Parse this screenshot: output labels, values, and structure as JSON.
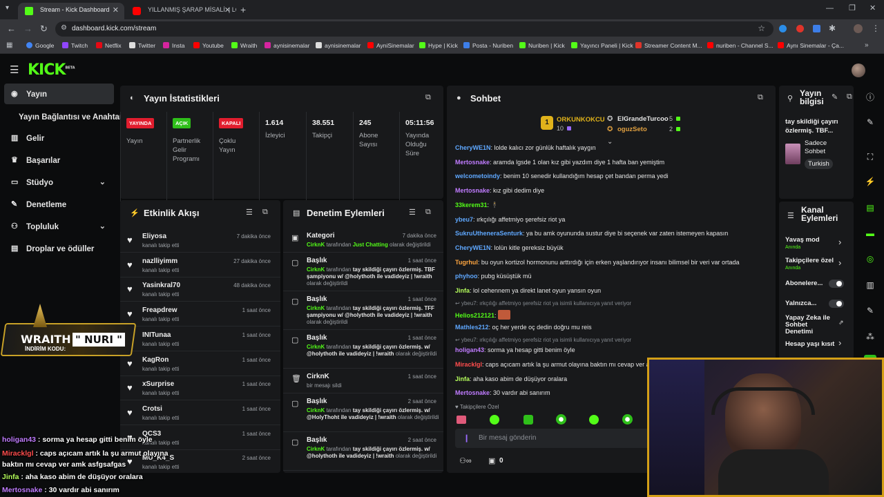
{
  "browser": {
    "tabs": [
      {
        "title": "Stream - Kick Dashboard",
        "active": true
      },
      {
        "title": "YILLANMIŞ ŞARAP MİSALİ. | LO",
        "active": false
      }
    ],
    "url": "dashboard.kick.com/stream",
    "bookmarks": [
      "Google",
      "Twitch",
      "Netflix",
      "Twitter",
      "Insta",
      "Youtube",
      "Wraith",
      "aynisinemalar",
      "aynisinemalar",
      "AyniSinemalar",
      "Hype | Kick",
      "Posta - Nuriben",
      "Nuriben | Kick",
      "Yayıncı Paneli | Kick",
      "Streamer Content M...",
      "nuriben - Channel S...",
      "Aynı Sinemalar - Ça..."
    ]
  },
  "brand": {
    "logo": "KICK",
    "beta": "BETA",
    "accent": "#53fc18"
  },
  "sidebar": {
    "items": [
      {
        "label": "Yayın",
        "icon": "broadcast-icon",
        "active": true
      },
      {
        "label": "Yayın Bağlantısı ve Anahtarı",
        "icon": "",
        "active": false
      },
      {
        "label": "Gelir",
        "icon": "bank-icon",
        "active": false
      },
      {
        "label": "Başarılar",
        "icon": "trophy-icon",
        "active": false
      },
      {
        "label": "Stüdyo",
        "icon": "monitor-icon",
        "active": false,
        "expandable": true
      },
      {
        "label": "Denetleme",
        "icon": "wrench-icon",
        "active": false
      },
      {
        "label": "Topluluk",
        "icon": "people-icon",
        "active": false,
        "expandable": true
      },
      {
        "label": "Droplar ve ödüller",
        "icon": "gift-icon",
        "active": false
      }
    ]
  },
  "stats": {
    "title": "Yayın İstatistikleri",
    "items": [
      {
        "badge": "YAYINDA",
        "badge_color": "#e11d2e",
        "label": "Yayın"
      },
      {
        "badge": "AÇIK",
        "badge_color": "#2fbf1a",
        "label": "Partnerlik Gelir Programı"
      },
      {
        "badge": "KAPALI",
        "badge_color": "#e11d2e",
        "label": "Çoklu Yayın"
      },
      {
        "value": "1.614",
        "label": "İzleyici"
      },
      {
        "value": "38.551",
        "label": "Takipçi"
      },
      {
        "value": "245",
        "label": "Abone Sayısı"
      },
      {
        "value": "05:11:56",
        "label": "Yayında Olduğu Süre"
      }
    ]
  },
  "activity": {
    "title": "Etkinlik Akışı",
    "rows": [
      {
        "name": "Eliyosa",
        "sub": "kanalı takip etti",
        "time": "7 dakika önce"
      },
      {
        "name": "nazlliyimm",
        "sub": "kanalı takip etti",
        "time": "27 dakika önce"
      },
      {
        "name": "Yasinkral70",
        "sub": "kanalı takip etti",
        "time": "48 dakika önce"
      },
      {
        "name": "Freapdrew",
        "sub": "kanalı takip etti",
        "time": "1 saat önce"
      },
      {
        "name": "INITunaa",
        "sub": "kanalı takip etti",
        "time": "1 saat önce"
      },
      {
        "name": "KagRon",
        "sub": "kanalı takip etti",
        "time": "1 saat önce"
      },
      {
        "name": "xSurprise",
        "sub": "kanalı takip etti",
        "time": "1 saat önce"
      },
      {
        "name": "Crotsi",
        "sub": "kanalı takip etti",
        "time": "1 saat önce"
      },
      {
        "name": "QCS3",
        "sub": "kanalı takip etti",
        "time": "1 saat önce"
      },
      {
        "name": "MU_K4_S",
        "sub": "kanalı takip etti",
        "time": "2 saat önce"
      }
    ]
  },
  "moderation": {
    "title": "Denetim Eylemleri",
    "rows": [
      {
        "icon": "category-icon",
        "title": "Kategori",
        "time": "7 dakika önce",
        "actor": "CirknK",
        "mid": " tarafından ",
        "target": "Just Chatting",
        "tail": " olarak değiştirildi"
      },
      {
        "icon": "title-icon",
        "title": "Başlık",
        "time": "1 saat önce",
        "actor": "CirknK",
        "mid": " tarafından ",
        "target": "tay skildiği çayırı özlermiş. TBF şampiyonu w/ @holythoth ile vadideyiz | !wraith",
        "tail": " olarak değiştirildi"
      },
      {
        "icon": "title-icon",
        "title": "Başlık",
        "time": "1 saat önce",
        "actor": "CirknK",
        "mid": " tarafından ",
        "target": "tay skildiği çayırı özlermiş. TFF şampiyonu w/ @holythoth ile vadideyiz | !wraith",
        "tail": " olarak değiştirildi"
      },
      {
        "icon": "title-icon",
        "title": "Başlık",
        "time": "1 saat önce",
        "actor": "CirknK",
        "mid": " tarafından ",
        "target": "tay skildiği çayırı özlermiş. w/ @holythoth ile vadideyiz | !wraith",
        "tail": " olarak değiştirildi"
      },
      {
        "icon": "trash-icon",
        "title": "CirknK",
        "time": "1 saat önce",
        "actor": "",
        "mid": "bir mesajı sildi",
        "target": "",
        "tail": ""
      },
      {
        "icon": "title-icon",
        "title": "Başlık",
        "time": "2 saat önce",
        "actor": "CirknK",
        "mid": " tarafından ",
        "target": "tay skildiği çayırı özlermiş. w/ @HolyThoht ile vadideyiz | !wraith",
        "tail": " olarak değiştirildi"
      },
      {
        "icon": "title-icon",
        "title": "Başlık",
        "time": "2 saat önce",
        "actor": "CirknK",
        "mid": " tarafından ",
        "target": "tay skildiği çayırı özlermiş. w/ @holythoth ile vadideyiz | !wraith",
        "tail": " olarak değiştirildi"
      }
    ]
  },
  "chat": {
    "title": "Sohbet",
    "leaderboard": [
      {
        "rank": "1",
        "name": "ORKUNKOKCU",
        "value": "10"
      },
      {
        "rank": "",
        "name": "ElGrandeTurcoo",
        "value": "5"
      },
      {
        "rank": "",
        "name": "oguzSeto",
        "value": "2"
      }
    ],
    "messages": [
      {
        "user": "CheryWE1N",
        "color": "#5fa8ff",
        "text": "lolde kalıcı zor günlük haftalık yaygın"
      },
      {
        "user": "Mertosnake",
        "color": "#c07cff",
        "text": "aramda lgsde 1 olan kız gibi yazdım diye 1 hafta ban yemiştim"
      },
      {
        "user": "welcometoindy",
        "color": "#5fa8ff",
        "text": "benim 10 senedir kullandığım hesap çet bandan perma yedi"
      },
      {
        "user": "Mertosnake",
        "color": "#c07cff",
        "text": "kız gibi dedim diye"
      },
      {
        "user": "33kerem31",
        "color": "#53fc18",
        "text": "🕴"
      },
      {
        "user": "ybeu7",
        "color": "#5fa8ff",
        "text": "ırkçılığı affetmiyo şerefsiz riot ya"
      },
      {
        "user": "SukruUtheneraSenturk",
        "color": "#5fa8ff",
        "text": "ya bu amk oyununda sustur diye bi seçenek var zaten istemeyen kapasın"
      },
      {
        "user": "CheryWE1N",
        "color": "#5fa8ff",
        "text": "lolün kitle gereksiz büyük"
      },
      {
        "user": "Tugrhul",
        "color": "#ffa640",
        "text": "bu oyun kortizol hormonunu arttırdığı için erken yaşlandırıyor insanı bilimsel bir veri var ortada"
      },
      {
        "user": "phyhoo",
        "color": "#5fa8ff",
        "text": "pubg küsüştük mü"
      },
      {
        "user": "Jinfa",
        "color": "#b6ff5c",
        "text": "lol cehennem ya direkt lanet oyun yansın oyun"
      },
      {
        "user": "Helios212121",
        "color": "#53fc18",
        "text": "",
        "reply": "ybeu7: ırkçılığı affetmiyo şerefsiz riot ya isimli kullanıcıya yanıt veriyor"
      },
      {
        "user": "Mathles212",
        "color": "#5fa8ff",
        "text": "oç her yerde oç dedin doğru mu reis"
      },
      {
        "user": "holigan43",
        "color": "#c07cff",
        "text": "sorma ya hesap gitti benim öyle",
        "reply": "ybeu7: ırkçılığı affetmiyo şerefsiz riot ya isimli kullanıcıya yanıt veriyor"
      },
      {
        "user": "Miracklgl",
        "color": "#ff4d4d",
        "text": "caps açıcam artık la şu armut olayına baktın mı cevap ver amk asfgsafgas"
      },
      {
        "user": "Jinfa",
        "color": "#b6ff5c",
        "text": "aha kaso abim de düşüyor oralara"
      },
      {
        "user": "Mertosnake",
        "color": "#c07cff",
        "text": "30 vardır abi sanırım"
      }
    ],
    "follower_only": "Takipçilere Özel",
    "input_placeholder": "Bir mesaj gönderin",
    "count": "0"
  },
  "stream_info": {
    "title": "Yayın bilgisi",
    "stream_title": "tay skildiği çayırı özlermiş. TBF...",
    "category": "Sadece Sohbet",
    "language": "Turkish"
  },
  "channel_actions": {
    "title": "Kanal Eylemleri",
    "items": [
      {
        "label": "Yavaş mod",
        "sub": "Anında",
        "control": "chevron"
      },
      {
        "label": "Takipçilere özel",
        "sub": "Anında",
        "control": "chevron"
      },
      {
        "label": "Abonelere...",
        "sub": "",
        "control": "toggle"
      },
      {
        "label": "Yalnızca...",
        "sub": "",
        "control": "toggle"
      },
      {
        "label": "Yapay Zeka ile Sohbet Denetimi",
        "sub": "",
        "control": "external"
      },
      {
        "label": "Hesap yaşı kısıt",
        "sub": "",
        "control": "chevron"
      }
    ]
  },
  "overlay": {
    "sponsor_brand": "WRAITH",
    "sponsor_code_label": "İNDİRİM KODU:",
    "sponsor_code": "\" NURI \"",
    "chat_lines": [
      {
        "user": "holigan43",
        "color": "#c07cff",
        "text": " : sorma ya hesap gitti benim öyle"
      },
      {
        "user": "Miracklgl",
        "color": "#ff4d4d",
        "text": " : caps açıcam artık la şu armut olayına"
      },
      {
        "user": "",
        "color": "#ffffff",
        "text": "baktın mı cevap ver amk asfgsafgas"
      },
      {
        "user": "Jinfa",
        "color": "#b6ff5c",
        "text": " : aha kaso abim de düşüyor oralara"
      },
      {
        "user": "Mertosnake",
        "color": "#c07cff",
        "text": " : 30 vardır abi sanırım"
      }
    ]
  }
}
